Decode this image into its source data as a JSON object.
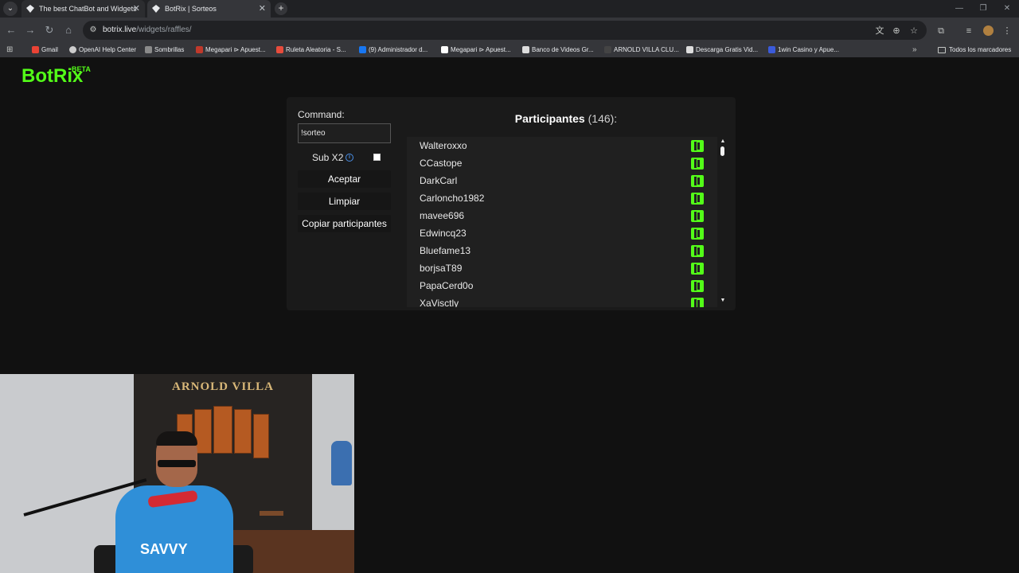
{
  "browser": {
    "tabs": [
      {
        "title": "The best ChatBot and Widgets",
        "active": false
      },
      {
        "title": "BotRix | Sorteos",
        "active": true
      }
    ],
    "url_host": "botrix.live",
    "url_path": "/widgets/raffles/",
    "bookmarks": [
      {
        "label": "Gmail",
        "color": "#ea4335"
      },
      {
        "label": "OpenAI Help Center",
        "color": "#cccccc"
      },
      {
        "label": "Sombrillas",
        "color": "#8a8a8a"
      },
      {
        "label": "Megapari ⊳ Apuest...",
        "color": "#c0392b"
      },
      {
        "label": "Ruleta Aleatoria - S...",
        "color": "#e74c3c"
      },
      {
        "label": "(9) Administrador d...",
        "color": "#1877f2"
      },
      {
        "label": "Megapari ⊳ Apuest...",
        "color": "#ffffff"
      },
      {
        "label": "Banco de Videos Gr...",
        "color": "#dddddd"
      },
      {
        "label": "ARNOLD VILLA CLU...",
        "color": "#444444"
      },
      {
        "label": "Descarga Gratis Vid...",
        "color": "#dddddd"
      },
      {
        "label": "1win Casino y Apue...",
        "color": "#3b5bdb"
      }
    ],
    "bookmarks_more": "»",
    "all_bookmarks": "Todos los marcadores"
  },
  "header": {
    "logo": "BotRix",
    "logo_badge": "BETA"
  },
  "raffle": {
    "command_label": "Command:",
    "command_value": "!sorteo",
    "sub_label": "Sub X2",
    "sub_checked": false,
    "accept_button": "Aceptar",
    "clear_button": "Limpiar",
    "copy_button": "Copiar participantes"
  },
  "participants": {
    "title": "Participantes",
    "count": "(146):",
    "platform_icon": "kick-icon",
    "accent_color": "#53fc18",
    "list": [
      "Walteroxxo",
      "CCastope",
      "DarkCarl",
      "Carloncho1982",
      "mavee696",
      "Edwincq23",
      "Bluefame13",
      "borjsaT89",
      "PapaCerd0o",
      "XaVisctly"
    ]
  },
  "webcam": {
    "sign": "ARNOLD VILLA",
    "shirt_text": "SAVVY"
  }
}
